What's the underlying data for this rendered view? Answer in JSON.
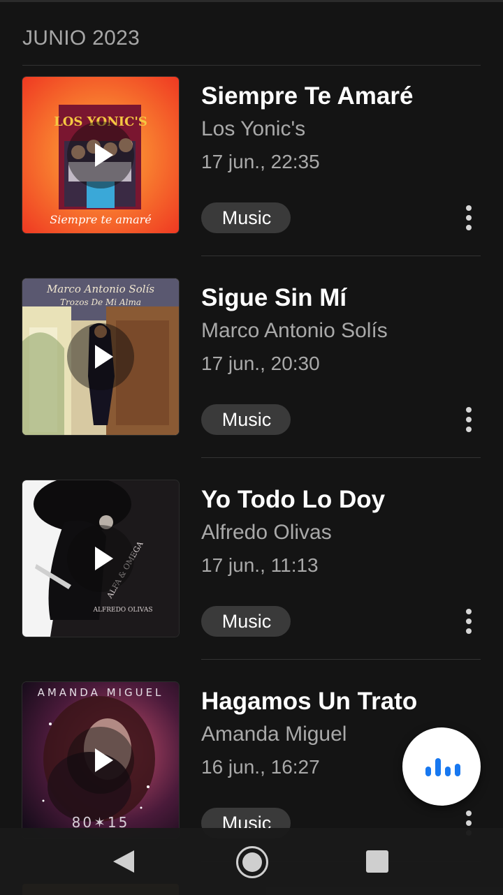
{
  "section": {
    "header": "JUNIO 2023"
  },
  "badge": {
    "apple_glyph": "",
    "label": "Music"
  },
  "songs": [
    {
      "title": "Siempre Te Amaré",
      "artist": "Los Yonic's",
      "date": "17 jun., 22:35",
      "art_text_top": "LOS YONIC'S",
      "art_text_bottom": "Siempre te amaré"
    },
    {
      "title": "Sigue Sin Mí",
      "artist": "Marco Antonio Solís",
      "date": "17 jun., 20:30",
      "art_text_top": "Marco Antonio Solís",
      "art_text_bottom": "Trozos De Mi Alma"
    },
    {
      "title": "Yo Todo Lo Doy",
      "artist": "Alfredo Olivas",
      "date": "17 jun., 11:13",
      "art_text_top": "ALFA & OMEGA",
      "art_text_bottom": "ALFREDO OLIVAS"
    },
    {
      "title": "Hagamos Un Trato",
      "artist": "Amanda Miguel",
      "date": "16 jun., 16:27",
      "art_text_top": "AMANDA MIGUEL",
      "art_text_bottom": "80✶15"
    }
  ],
  "colors": {
    "background": "#141414",
    "accent": "#1878f0",
    "pill": "#3a3a3a",
    "secondary_text": "#a9a9a9"
  },
  "icons": {
    "play": "play-icon",
    "more": "more-vert-icon",
    "fab": "audio-recognition-icon",
    "back": "nav-back-icon",
    "home": "nav-home-icon",
    "recents": "nav-recents-icon"
  }
}
